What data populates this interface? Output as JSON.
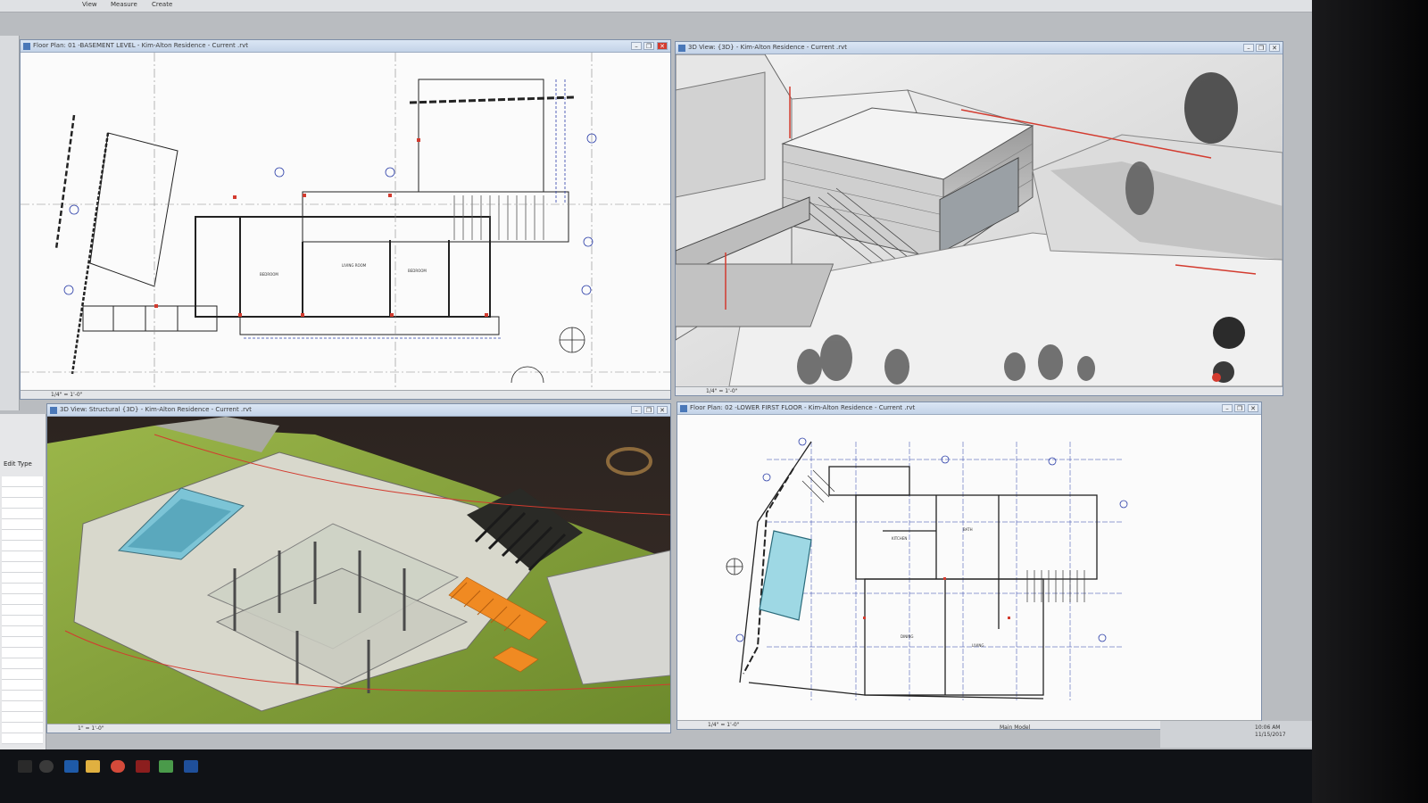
{
  "ribbon": {
    "tabs": [
      "View",
      "Measure",
      "Create"
    ]
  },
  "properties": {
    "edit_type": "Edit Type"
  },
  "views": {
    "top_left": {
      "title": "Floor Plan: 01 -BASEMENT LEVEL - Kim-Alton Residence - Current .rvt",
      "scale": "1/4\" = 1'-0\""
    },
    "top_right": {
      "title": "3D View: {3D} - Kim-Alton Residence - Current .rvt",
      "scale": "1/4\" = 1'-0\""
    },
    "bottom_left": {
      "title": "3D View: Structural {3D} - Kim-Alton Residence - Current .rvt",
      "scale": "1\" = 1'-0\""
    },
    "bottom_right": {
      "title": "Floor Plan: 02 -LOWER FIRST FLOOR - Kim-Alton Residence - Current .rvt",
      "scale": "1/4\" = 1'-0\""
    }
  },
  "window_buttons": {
    "minimize": "–",
    "restore": "❐",
    "close": "✕"
  },
  "statusbar": {
    "main_model": "Main Model"
  },
  "clock": {
    "time": "10:06 AM",
    "date": "11/15/2017"
  },
  "colors": {
    "accent": "#d33b2f",
    "titlebar": "#c3d3e8",
    "grass": "#8aa53c",
    "stairs": "#f08a22",
    "glass": "#8fd3e0"
  }
}
